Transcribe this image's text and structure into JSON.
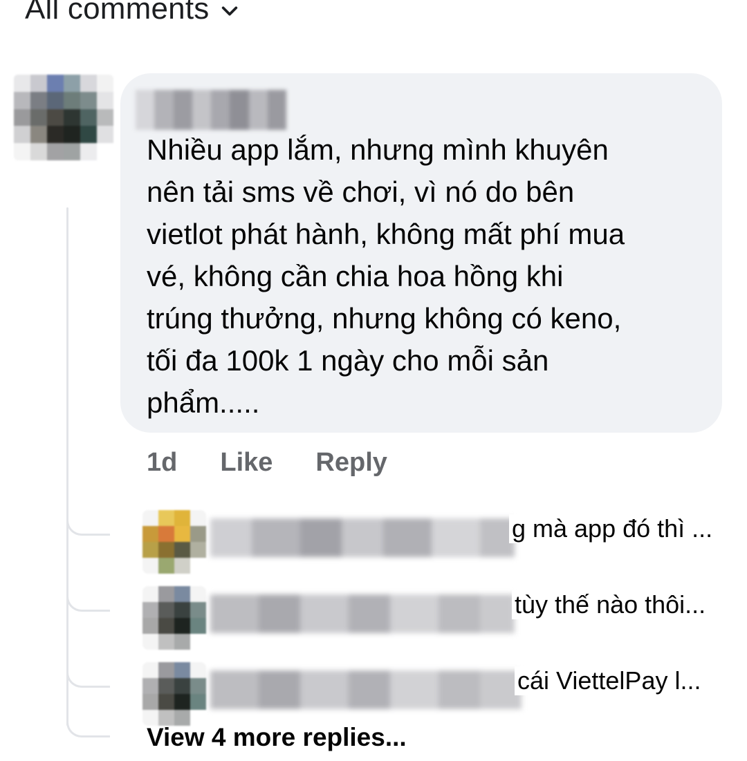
{
  "header": {
    "label": "All comments",
    "chevron_icon": "chevron-down-icon"
  },
  "comment": {
    "text": "Nhiều app lắm, nhưng mình khuyên\nnên tải sms về chơi, vì nó do bên\nvietlot phát hành, không mất phí mua\nvé, không cần chia hoa hồng khi\ntrúng thưởng, nhưng không có keno,\ntối đa 100k 1 ngày cho mỗi sản\nphẩm.....",
    "time": "1d",
    "like_label": "Like",
    "reply_label": "Reply"
  },
  "replies": [
    {
      "text": "g mà app đó thì ..."
    },
    {
      "text": "tùy thế nào thôi..."
    },
    {
      "text": "cái ViettelPay l..."
    }
  ],
  "view_more_label": "View 4 more replies...",
  "colors": {
    "bubble": "#f0f2f5",
    "text": "#050505",
    "secondary": "#65676b",
    "thread_line": "#e2e4e8"
  }
}
